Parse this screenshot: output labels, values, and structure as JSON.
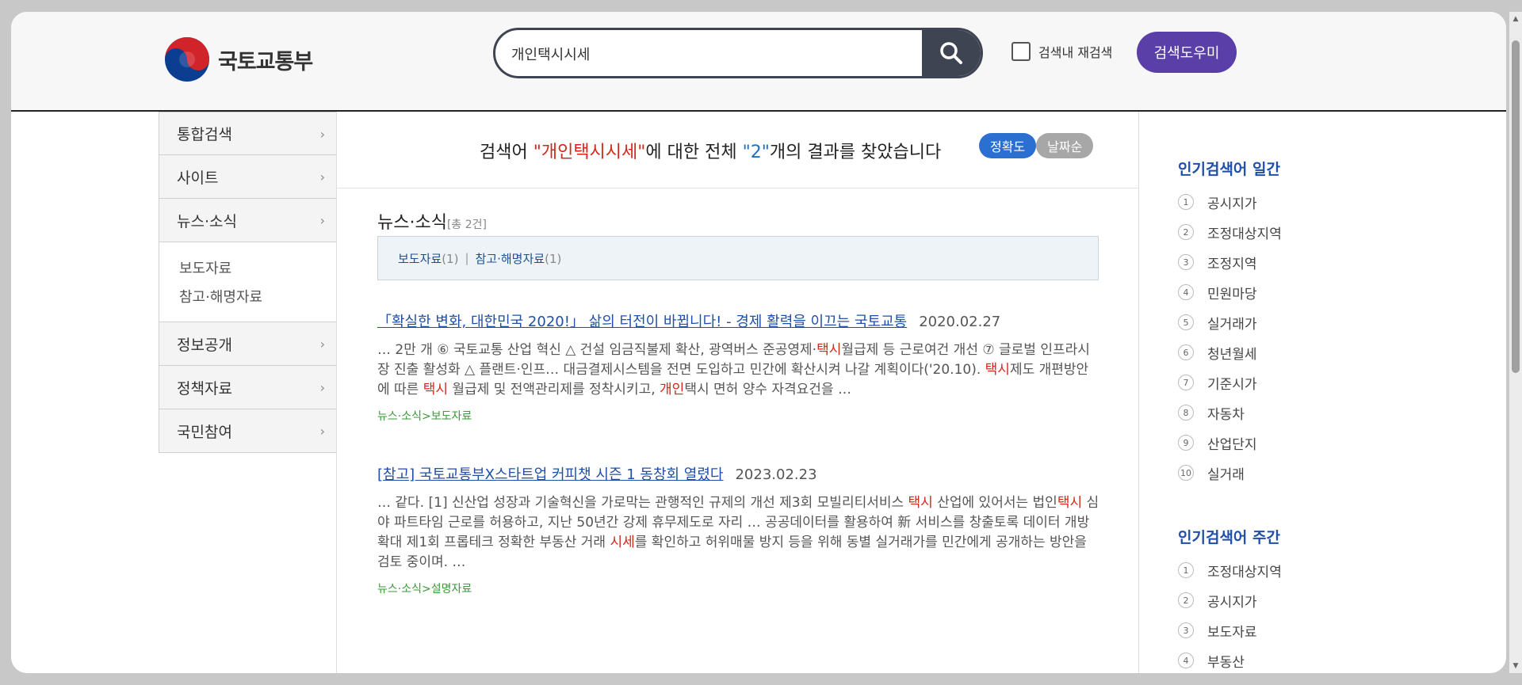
{
  "header": {
    "logo_text": "국토교통부",
    "search_value": "개인택시시세",
    "recheck_label": "검색내 재검색",
    "help_label": "검색도우미"
  },
  "lnb": {
    "items_top": [
      {
        "label": "통합검색"
      },
      {
        "label": "사이트"
      },
      {
        "label": "뉴스·소식"
      }
    ],
    "sub_items": [
      "보도자료",
      "참고·해명자료"
    ],
    "items_bottom": [
      {
        "label": "정보공개"
      },
      {
        "label": "정책자료"
      },
      {
        "label": "국민참여"
      }
    ]
  },
  "result": {
    "prefix": "검색어 ",
    "keyword": "\"개인택시시세\"",
    "middle": "에 대한 전체 ",
    "count": "\"2\"",
    "suffix": "개의 결과를 찾았습니다",
    "sort_accuracy": "정확도",
    "sort_date": "날짜순"
  },
  "section": {
    "title": "뉴스·소식",
    "total": "[총 2건]",
    "cat1": "보도자료",
    "cat1_count": "(1)",
    "cat2": "참고·해명자료",
    "cat2_count": "(1)",
    "separator": "|"
  },
  "items": [
    {
      "title": "「확실한 변화, 대한민국 2020!」 삶의 터전이 바뀝니다! - 경제 활력을 이끄는 국토교통",
      "date": "2020.02.27",
      "desc": [
        {
          "t": "… 2만 개 ⑥ 국토교통 산업 혁신 △ 건설 임금직불제 확산, 광역버스 준공영제·",
          "h": false
        },
        {
          "t": "택시",
          "h": true
        },
        {
          "t": "월급제 등 근로여건 개선 ⑦ 글로벌 인프라시장 진출 활성화 △ 플랜트·인프… 대금결제시스템을 전면 도입하고 민간에 확산시켜 나갈 계획이다('20.10). ",
          "h": false
        },
        {
          "t": "택시",
          "h": true
        },
        {
          "t": "제도 개편방안에 따른 ",
          "h": false
        },
        {
          "t": "택시",
          "h": true
        },
        {
          "t": " 월급제 및 전액관리제를 정착시키고, ",
          "h": false
        },
        {
          "t": "개인",
          "h": true
        },
        {
          "t": "택시 면허 양수 자격요건을 …",
          "h": false
        }
      ],
      "path": "뉴스·소식>보도자료"
    },
    {
      "title": "[참고] 국토교통부X스타트업 커피챗 시즌 1 동창회 열렸다",
      "date": "2023.02.23",
      "desc": [
        {
          "t": "… 같다. [1] 신산업 성장과 기술혁신을 가로막는 관행적인 규제의 개선 제3회 모빌리티서비스 ",
          "h": false
        },
        {
          "t": "택시",
          "h": true
        },
        {
          "t": " 산업에 있어서는 법인",
          "h": false
        },
        {
          "t": "택시",
          "h": true
        },
        {
          "t": " 심야 파트타임 근로를 허용하고, 지난 50년간 강제 휴무제도로 자리 … 공공데이터를 활용하여 新 서비스를 창출토록 데이터 개방 확대 제1회 프롭테크 정확한 부동산 거래 ",
          "h": false
        },
        {
          "t": "시세",
          "h": true
        },
        {
          "t": "를 확인하고 허위매물 방지 등을 위해 동별 실거래가를 민간에게 공개하는 방안을 검토 중이며. …",
          "h": false
        }
      ],
      "path": "뉴스·소식>설명자료"
    }
  ],
  "popular_daily": {
    "title": "인기검색어 일간",
    "items": [
      {
        "num": "1",
        "label": "공시지가"
      },
      {
        "num": "2",
        "label": "조정대상지역"
      },
      {
        "num": "3",
        "label": "조정지역"
      },
      {
        "num": "4",
        "label": "민원마당"
      },
      {
        "num": "5",
        "label": "실거래가"
      },
      {
        "num": "6",
        "label": "청년월세"
      },
      {
        "num": "7",
        "label": "기준시가"
      },
      {
        "num": "8",
        "label": "자동차"
      },
      {
        "num": "9",
        "label": "산업단지"
      },
      {
        "num": "10",
        "label": "실거래"
      }
    ]
  },
  "popular_weekly": {
    "title": "인기검색어 주간",
    "items": [
      {
        "num": "1",
        "label": "조정대상지역"
      },
      {
        "num": "2",
        "label": "공시지가"
      },
      {
        "num": "3",
        "label": "보도자료"
      },
      {
        "num": "4",
        "label": "부동산"
      }
    ]
  },
  "colors": {
    "accent_purple": "#5a3fa8",
    "search_dark": "#3f4452",
    "highlight_red": "#d2281a",
    "link_blue": "#1f4fa8",
    "path_green": "#3a9a3a"
  },
  "icons": [
    "emblem-icon",
    "search-icon",
    "chevron-right-icon"
  ]
}
